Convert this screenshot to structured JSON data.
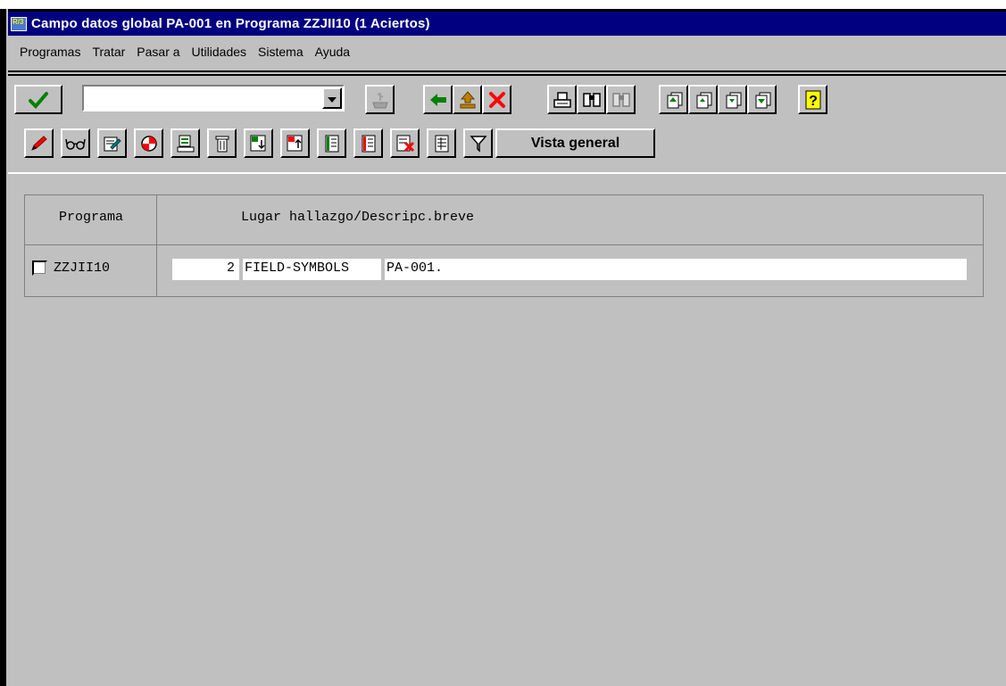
{
  "window": {
    "title": "Campo datos global PA-001 en Programa ZZJII10 (1 Aciertos)",
    "title_icon": "sap-window-icon",
    "title_icon_text": "R/3"
  },
  "menu": [
    {
      "label": "Programas"
    },
    {
      "label": "Tratar"
    },
    {
      "label": "Pasar a"
    },
    {
      "label": "Utilidades"
    },
    {
      "label": "Sistema"
    },
    {
      "label": "Ayuda"
    }
  ],
  "toolbar1": {
    "command_field_value": "",
    "icons": [
      "enter-check-icon",
      "dropdown-arrow-icon",
      "save-icon",
      "back-icon",
      "exit-up-icon",
      "cancel-icon",
      "print-icon",
      "find-icon",
      "find-next-icon",
      "first-page-icon",
      "previous-page-icon",
      "next-page-icon",
      "last-page-icon",
      "help-icon"
    ]
  },
  "toolbar2": {
    "icons": [
      "change-pencil-icon",
      "display-glasses-icon",
      "edit-icon",
      "breakpoint-icon",
      "where-used-icon",
      "delete-trash-icon",
      "expand-icon",
      "collapse-icon",
      "list-icon",
      "list-red-icon",
      "cancel-list-icon",
      "select-icon",
      "filter-icon"
    ],
    "vista_general_label": "Vista general"
  },
  "grid": {
    "headers": {
      "col1": "Programa",
      "col2": "Lugar hallazgo/Descripc.breve"
    },
    "rows": [
      {
        "checked": false,
        "programa": "ZZJII10",
        "line": "2",
        "text1": "FIELD-SYMBOLS",
        "text2": "PA-001."
      }
    ]
  },
  "colors": {
    "titlebar": "#000080",
    "background": "#c0c0c0",
    "check_green": "#008000",
    "cancel_red": "#ff0000",
    "help_yellow": "#ffff00"
  }
}
